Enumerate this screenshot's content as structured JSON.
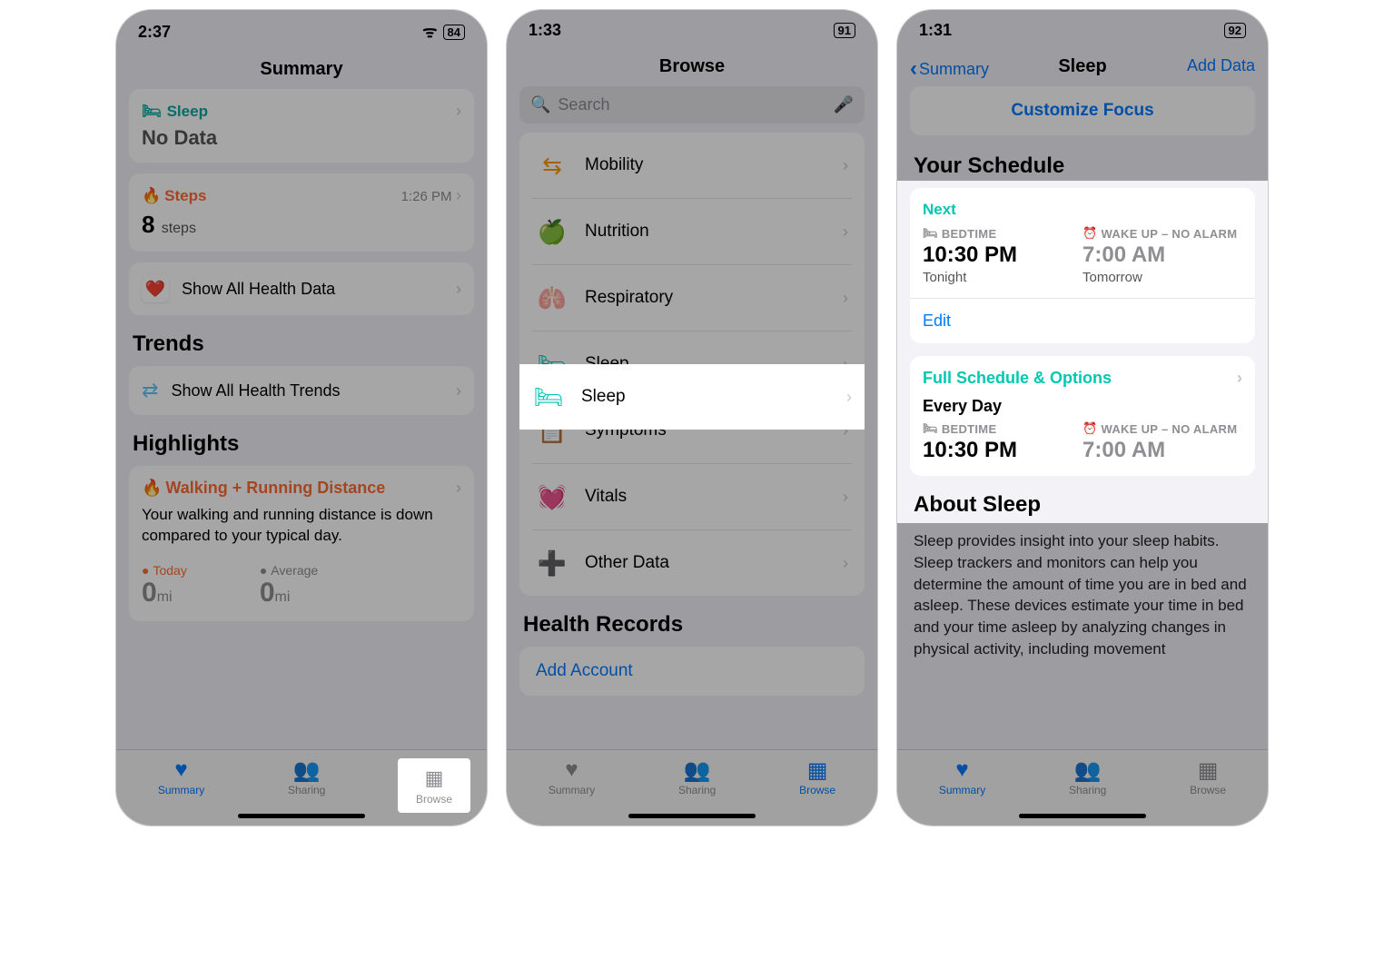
{
  "screen1": {
    "time": "2:37",
    "battery": "84",
    "title": "Summary",
    "sleep": {
      "label": "Sleep",
      "nodata": "No Data"
    },
    "steps": {
      "label": "Steps",
      "time": "1:26 PM",
      "value": "8",
      "unit": "steps"
    },
    "show_all_health": "Show All Health Data",
    "trends_title": "Trends",
    "show_all_trends": "Show All Health Trends",
    "highlights_title": "Highlights",
    "hl": {
      "title": "Walking + Running Distance",
      "body": "Your walking and running distance is down compared to your typical day.",
      "today_label": "Today",
      "today_val": "0",
      "today_unit": "mi",
      "avg_label": "Average",
      "avg_val": "0",
      "avg_unit": "mi"
    },
    "tabs": {
      "summary": "Summary",
      "sharing": "Sharing",
      "browse": "Browse"
    }
  },
  "screen2": {
    "time": "1:33",
    "battery": "91",
    "title": "Browse",
    "search_placeholder": "Search",
    "items": {
      "mobility": "Mobility",
      "nutrition": "Nutrition",
      "respiratory": "Respiratory",
      "sleep": "Sleep",
      "symptoms": "Symptoms",
      "vitals": "Vitals",
      "other": "Other Data"
    },
    "records_title": "Health Records",
    "add_account": "Add Account",
    "tabs": {
      "summary": "Summary",
      "sharing": "Sharing",
      "browse": "Browse"
    }
  },
  "screen3": {
    "time": "1:31",
    "battery": "92",
    "back": "Summary",
    "title": "Sleep",
    "add_data": "Add Data",
    "customize": "Customize Focus",
    "schedule_title": "Your Schedule",
    "next": "Next",
    "bedtime_label": "BEDTIME",
    "wakeup_label": "WAKE UP – NO ALARM",
    "bedtime": "10:30 PM",
    "wakeup": "7:00 AM",
    "tonight": "Tonight",
    "tomorrow": "Tomorrow",
    "edit": "Edit",
    "full_schedule": "Full Schedule & Options",
    "every_day": "Every Day",
    "bedtime2": "10:30 PM",
    "wakeup2": "7:00 AM",
    "about_title": "About Sleep",
    "about_body": "Sleep provides insight into your sleep habits. Sleep trackers and monitors can help you determine the amount of time you are in bed and asleep. These devices estimate your time in bed and your time asleep by analyzing changes in physical activity, including movement",
    "tabs": {
      "summary": "Summary",
      "sharing": "Sharing",
      "browse": "Browse"
    }
  }
}
